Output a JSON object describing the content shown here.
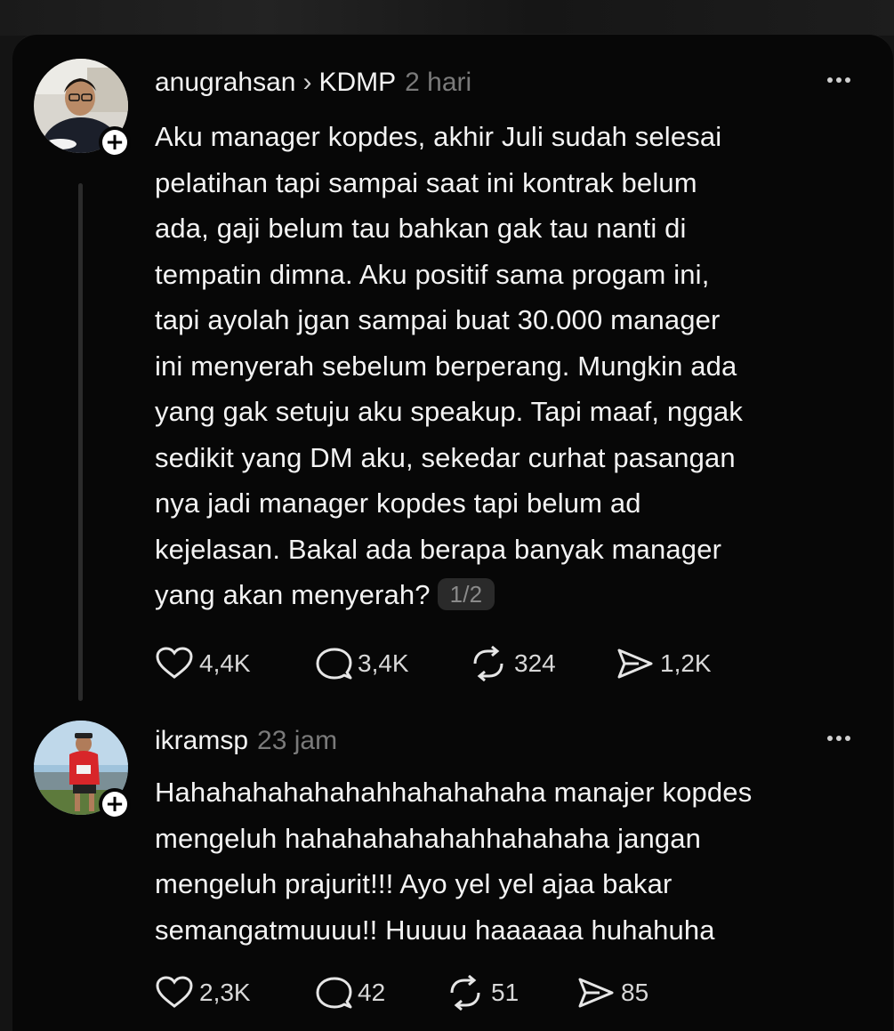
{
  "posts": [
    {
      "username": "anugrahsan",
      "community": "KDMP",
      "time": "2 hari",
      "lines": [
        "Aku manager kopdes, akhir Juli sudah selesai",
        "pelatihan tapi sampai saat ini kontrak belum",
        "ada, gaji belum tau bahkan gak tau nanti di",
        "tempatin dimna. Aku positif sama progam ini,",
        "tapi ayolah jgan sampai buat 30.000 manager",
        "ini menyerah sebelum berperang. Mungkin ada",
        "yang gak setuju aku speakup. Tapi maaf, nggak",
        "sedikit yang DM aku, sekedar curhat pasangan",
        "nya jadi manager kopdes tapi belum ad",
        "kejelasan. Bakal ada berapa banyak manager",
        "yang akan menyerah?"
      ],
      "page_indicator": "1/2",
      "likes": "4,4K",
      "replies": "3,4K",
      "reposts": "324",
      "shares": "1,2K"
    },
    {
      "username": "ikramsp",
      "time": "23 jam",
      "lines": [
        "Hahahahahahahahhahahahaha manajer kopdes",
        "mengeluh hahahahahahahhahahaha jangan",
        "mengeluh prajurit!!! Ayo yel yel ajaa bakar",
        "semangatmuuuu!! Huuuu haaaaaa huhahuha"
      ],
      "likes": "2,3K",
      "replies": "42",
      "reposts": "51",
      "shares": "85"
    }
  ],
  "icons": {
    "like": "heart-icon",
    "reply": "comment-icon",
    "repost": "repost-icon",
    "share": "send-icon",
    "more": "more-dots-icon",
    "follow": "plus-icon"
  },
  "colors": {
    "background": "#070707",
    "text": "#f3f3f3",
    "muted": "#7a7a7a"
  }
}
